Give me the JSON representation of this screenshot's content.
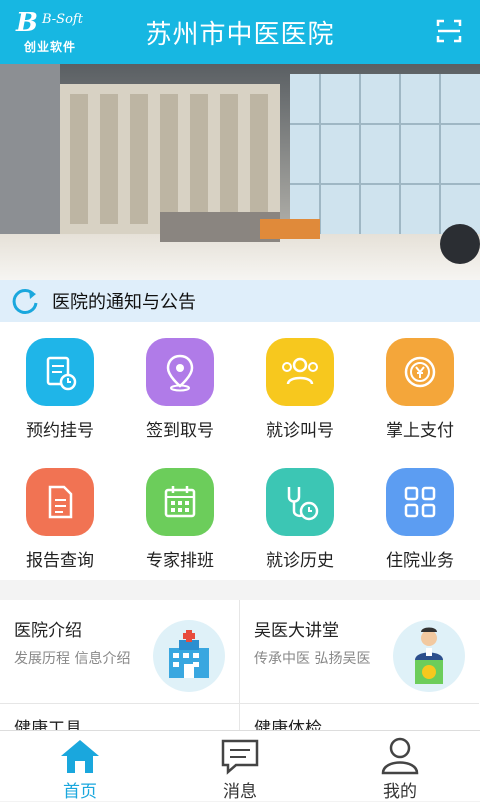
{
  "header": {
    "logo_brand": "B-Soft",
    "logo_text": "创业软件",
    "title": "苏州市中医医院"
  },
  "banner": {
    "active_slide": 1,
    "slide_count": 4
  },
  "notice": {
    "label": "医院的通知与公告"
  },
  "services": [
    {
      "label": "预约挂号",
      "icon": "clipboard-clock-icon",
      "color": "#1fb5e8"
    },
    {
      "label": "签到取号",
      "icon": "location-pin-icon",
      "color": "#b07be8"
    },
    {
      "label": "就诊叫号",
      "icon": "people-group-icon",
      "color": "#f7c81e"
    },
    {
      "label": "掌上支付",
      "icon": "yen-coin-icon",
      "color": "#f4a63a"
    },
    {
      "label": "报告查询",
      "icon": "document-icon",
      "color": "#f17353"
    },
    {
      "label": "专家排班",
      "icon": "calendar-icon",
      "color": "#6ccd5b"
    },
    {
      "label": "就诊历史",
      "icon": "stethoscope-clock-icon",
      "color": "#3cc6b4"
    },
    {
      "label": "住院业务",
      "icon": "grid-apps-icon",
      "color": "#5c9df2"
    }
  ],
  "cards": [
    {
      "title": "医院介绍",
      "subtitle": "发展历程 信息介绍",
      "icon": "hospital-building-icon"
    },
    {
      "title": "吴医大讲堂",
      "subtitle": "传承中医 弘扬吴医",
      "icon": "lecturer-podium-icon"
    },
    {
      "title": "健康工具",
      "subtitle": "",
      "icon": ""
    },
    {
      "title": "健康体检",
      "subtitle": "",
      "icon": ""
    }
  ],
  "tabs": [
    {
      "label": "首页",
      "icon": "home-icon",
      "active": true,
      "color": "#1aa7dd"
    },
    {
      "label": "消息",
      "icon": "message-icon",
      "active": false,
      "color": "#333333"
    },
    {
      "label": "我的",
      "icon": "user-icon",
      "active": false,
      "color": "#333333"
    }
  ]
}
